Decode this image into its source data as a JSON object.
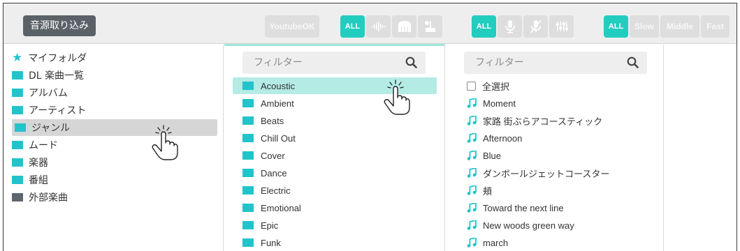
{
  "toolbar": {
    "import_label": "音源取り込み",
    "youtube_ok_label": "YoutubeOK",
    "all_label": "ALL",
    "tempo_slow": "Slow",
    "tempo_middle": "Middle",
    "tempo_fast": "Fast"
  },
  "tree": [
    {
      "label": "マイフォルダ",
      "icon": "star-icon"
    },
    {
      "label": "DL 楽曲一覧",
      "icon": "folder-icon"
    },
    {
      "label": "アルバム",
      "icon": "folder-icon"
    },
    {
      "label": "アーティスト",
      "icon": "folder-icon"
    },
    {
      "label": "ジャンル",
      "icon": "folder-icon",
      "selected": true
    },
    {
      "label": "ムード",
      "icon": "folder-icon"
    },
    {
      "label": "楽器",
      "icon": "folder-icon"
    },
    {
      "label": "番組",
      "icon": "folder-icon"
    },
    {
      "label": "外部楽曲",
      "icon": "folder-icon"
    }
  ],
  "genre_filter_placeholder": "フィルター",
  "genres": [
    {
      "label": "Acoustic",
      "selected": true
    },
    {
      "label": "Ambient"
    },
    {
      "label": "Beats"
    },
    {
      "label": "Chill Out"
    },
    {
      "label": "Cover"
    },
    {
      "label": "Dance"
    },
    {
      "label": "Electric"
    },
    {
      "label": "Emotional"
    },
    {
      "label": "Epic"
    },
    {
      "label": "Funk"
    }
  ],
  "song_filter_placeholder": "フィルター",
  "select_all_label": "全選択",
  "songs": [
    "Moment",
    "家路 街ぶらアコースティック",
    "Afternoon",
    "Blue",
    "ダンボールジェットコースター",
    "頬",
    "Toward the next line",
    "New woods green way",
    "march"
  ],
  "colors": {
    "accent": "#22cdbf",
    "folder_teal": "#22c4cb",
    "selected_genre_bg": "#b4ebe5",
    "selected_tree_bg": "#d6d6d6"
  }
}
